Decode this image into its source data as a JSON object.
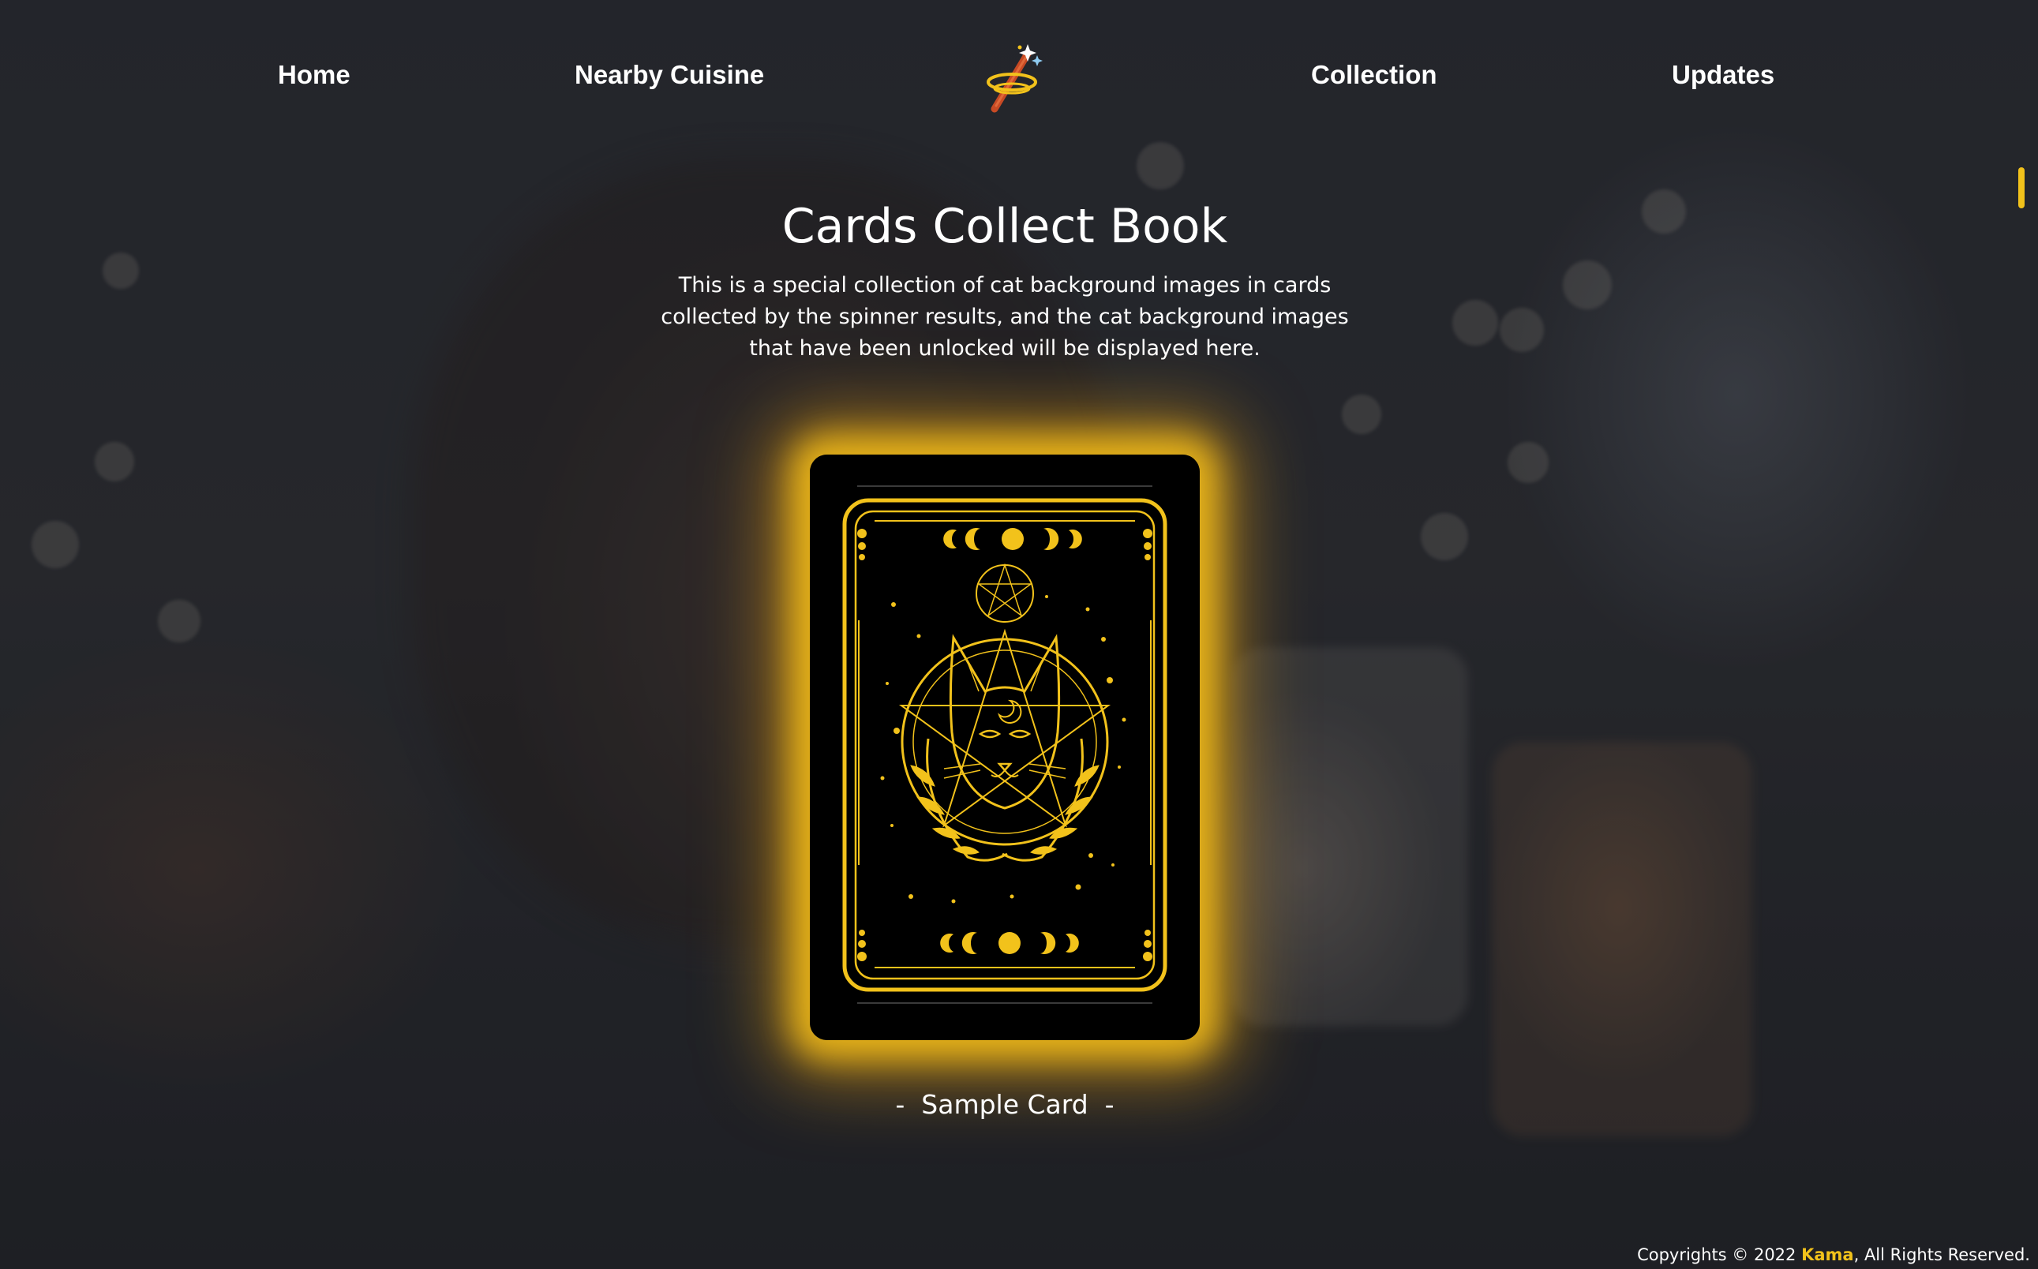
{
  "nav": {
    "items": [
      {
        "label": "Home"
      },
      {
        "label": "Nearby Cuisine"
      },
      {
        "label": "Collection"
      },
      {
        "label": "Updates"
      }
    ],
    "logo_icon": "magic-wand-icon"
  },
  "hero": {
    "title": "Cards Collect Book",
    "description": "This is a special collection of cat background images in cards collected by the spinner results, and the cat background images that have been unlocked will be displayed here."
  },
  "card": {
    "caption": "-  Sample Card  -",
    "icon": "tarot-cat-card-icon"
  },
  "footer": {
    "prefix": "Copyrights © 2022 ",
    "brand": "Kama",
    "suffix": ", All Rights Reserved."
  },
  "colors": {
    "accent": "#f2c21b",
    "glow": "#f0a818",
    "background": "#23262b",
    "card_background": "#000000",
    "text": "#ffffff"
  }
}
